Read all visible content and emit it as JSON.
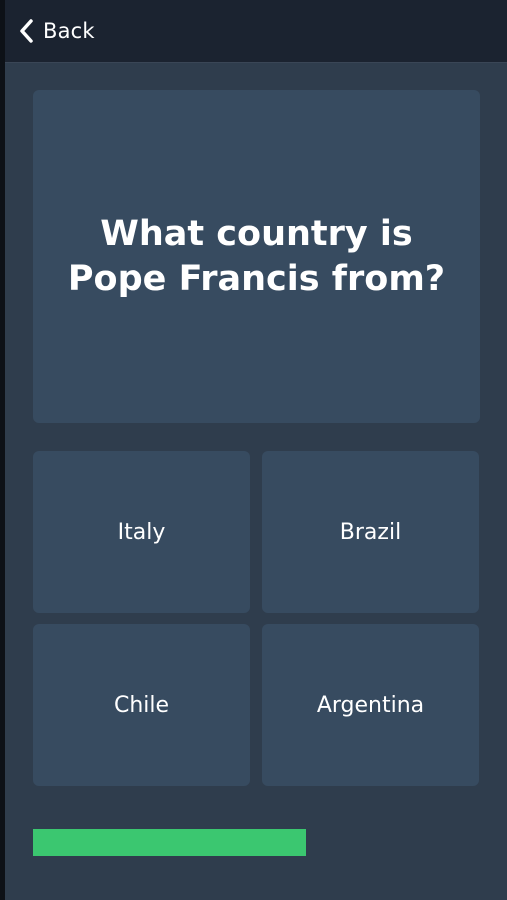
{
  "nav": {
    "back_label": "Back"
  },
  "question": {
    "text": "What country is Pope Francis from?"
  },
  "answers": [
    {
      "label": "Italy"
    },
    {
      "label": "Brazil"
    },
    {
      "label": "Chile"
    },
    {
      "label": "Argentina"
    }
  ],
  "progress": {
    "fraction": 0.61,
    "color": "#3bc770"
  },
  "colors": {
    "background": "#2f3d4d",
    "nav_bar": "#1b2330",
    "card": "#374b60",
    "text": "#ffffff"
  },
  "icons": {
    "back": "chevron-left-icon"
  }
}
